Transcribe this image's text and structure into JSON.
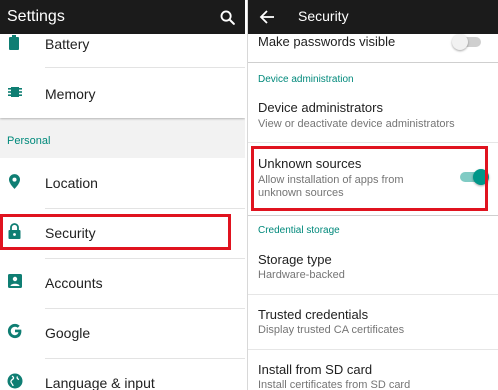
{
  "left": {
    "title": "Settings",
    "items_top": [
      {
        "label": "Battery",
        "icon": "battery-icon"
      },
      {
        "label": "Memory",
        "icon": "memory-icon"
      }
    ],
    "section_personal": "Personal",
    "items_personal": [
      {
        "label": "Location",
        "icon": "location-icon"
      },
      {
        "label": "Security",
        "icon": "lock-icon"
      },
      {
        "label": "Accounts",
        "icon": "accounts-icon"
      },
      {
        "label": "Google",
        "icon": "google-icon"
      },
      {
        "label": "Language & input",
        "icon": "globe-icon"
      }
    ]
  },
  "right": {
    "title": "Security",
    "make_passwords": {
      "title": "Make passwords visible",
      "enabled": false
    },
    "section_device_admin": "Device administration",
    "device_admins": {
      "title": "Device administrators",
      "subtitle": "View or deactivate device administrators"
    },
    "unknown_sources": {
      "title": "Unknown sources",
      "subtitle_line1": "Allow installation of apps from",
      "subtitle_line2": "unknown sources",
      "enabled": true
    },
    "section_credential": "Credential storage",
    "storage_type": {
      "title": "Storage type",
      "subtitle": "Hardware-backed"
    },
    "trusted_credentials": {
      "title": "Trusted credentials",
      "subtitle": "Display trusted CA certificates"
    },
    "install_sd": {
      "title": "Install from SD card",
      "subtitle": "Install certificates from SD card"
    }
  },
  "colors": {
    "accent": "#009688",
    "icon": "#0f7e73",
    "highlight": "#e0131f",
    "toolbar": "#1b1b1b"
  }
}
